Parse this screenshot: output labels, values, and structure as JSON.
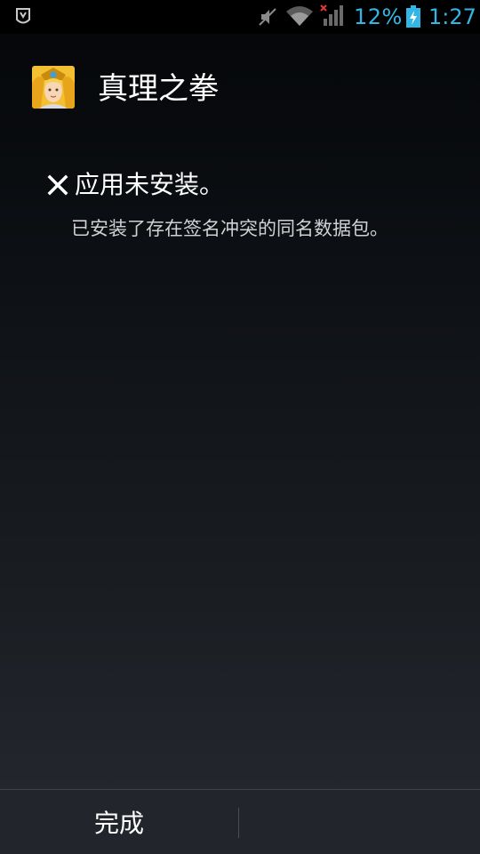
{
  "status_bar": {
    "battery_percent": "12%",
    "time": "1:27",
    "accent_color": "#33b5e5",
    "icons": [
      "notification-icon",
      "mute-icon",
      "wifi-icon",
      "signal-icon",
      "battery-icon"
    ]
  },
  "header": {
    "app_name": "真理之拳",
    "icon": "app-icon"
  },
  "message": {
    "title": "应用未安装。",
    "detail": "已安装了存在签名冲突的同名数据包。",
    "icon": "close-icon"
  },
  "buttons": {
    "done_label": "完成"
  }
}
